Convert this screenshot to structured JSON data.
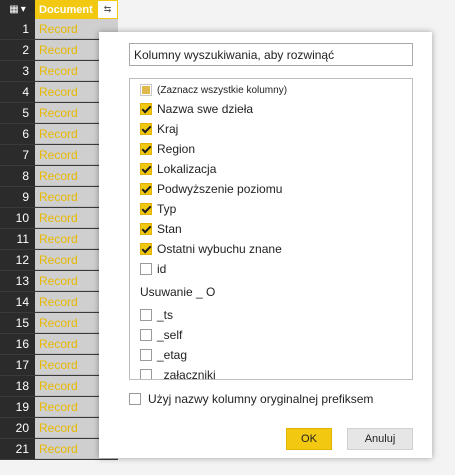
{
  "grid": {
    "column_header": "Document",
    "row_numbers": [
      "1",
      "2",
      "3",
      "4",
      "5",
      "6",
      "7",
      "8",
      "9",
      "10",
      "11",
      "12",
      "13",
      "14",
      "15",
      "16",
      "17",
      "18",
      "19",
      "20",
      "21"
    ],
    "cell_value": "Record"
  },
  "dialog": {
    "search_value": "Kolumny wyszukiwania, aby rozwinąć",
    "select_all": {
      "label": "(Zaznacz wszystkie kolumny)",
      "state": "indeterminate"
    },
    "columns": [
      {
        "label": "Nazwa swe dzieła",
        "checked": true
      },
      {
        "label": "Kraj",
        "checked": true
      },
      {
        "label": "Region",
        "checked": true
      },
      {
        "label": "Lokalizacja",
        "checked": true
      },
      {
        "label": "Podwyższenie poziomu",
        "checked": true
      },
      {
        "label": "Typ",
        "checked": true
      },
      {
        "label": "Stan",
        "checked": true
      },
      {
        "label": "Ostatni wybuchu znane",
        "checked": true
      },
      {
        "label": "id",
        "checked": false
      }
    ],
    "section_label": "Usuwanie _ O",
    "system_columns": [
      {
        "label": "_ts",
        "checked": false
      },
      {
        "label": "_self",
        "checked": false
      },
      {
        "label": "_etag",
        "checked": false
      },
      {
        "label": "_załączniki",
        "checked": false
      }
    ],
    "prefix_label": "Użyj nazwy kolumny oryginalnej prefiksem",
    "prefix_checked": false,
    "ok_label": "OK",
    "cancel_label": "Anuluj"
  },
  "colors": {
    "accent": "#f2c811",
    "row_header_bg": "#2b2b2b",
    "cell_bg": "#cfcfcf"
  }
}
